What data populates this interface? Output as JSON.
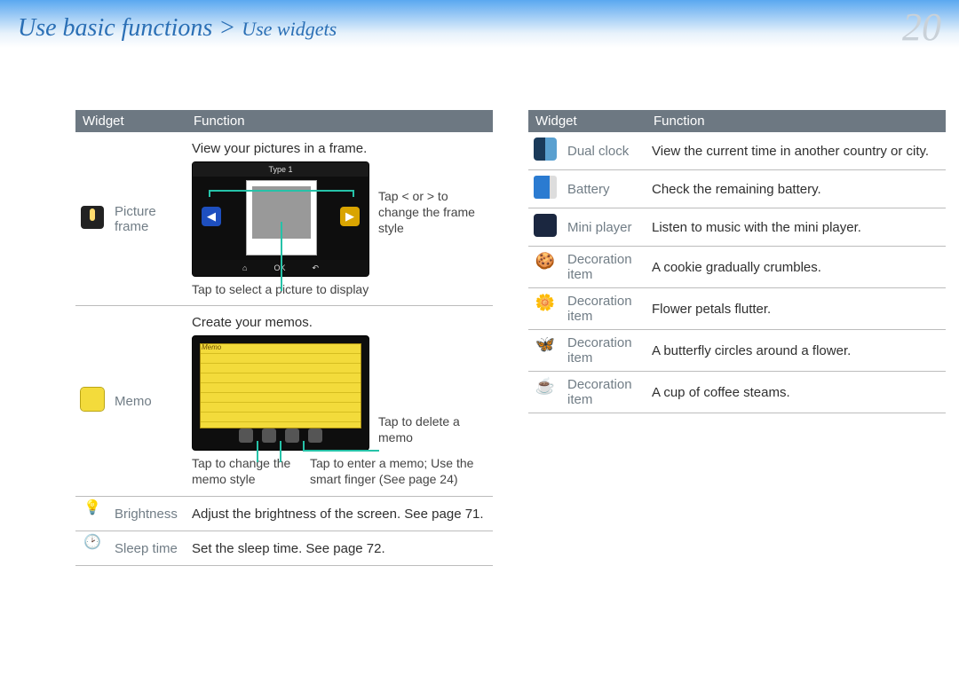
{
  "header": {
    "breadcrumb_main": "Use basic functions",
    "breadcrumb_sep": " > ",
    "breadcrumb_sub": "Use widgets",
    "page_number": "20"
  },
  "table_headers": {
    "widget": "Widget",
    "function": "Function"
  },
  "left": {
    "picture_frame": {
      "label": "Picture frame",
      "desc": "View your pictures in a frame.",
      "device_title": "Type 1",
      "ok": "OK",
      "arrow_note": "Tap < or > to change the frame style",
      "bottom_note": "Tap to select a picture to display"
    },
    "memo": {
      "label": "Memo",
      "desc": "Create your memos.",
      "pad_title": "Memo",
      "delete_note": "Tap to delete a memo",
      "style_note": "Tap to change the memo style",
      "enter_note": "Tap to enter a memo; Use the smart finger (See page 24)"
    },
    "brightness": {
      "label": "Brightness",
      "desc": "Adjust the brightness of the screen. See page 71."
    },
    "sleep": {
      "label": "Sleep time",
      "desc": "Set the sleep time. See page 72."
    }
  },
  "right": {
    "dual_clock": {
      "label": "Dual clock",
      "desc": "View the current time in another country or city."
    },
    "battery": {
      "label": "Battery",
      "desc": "Check the remaining battery."
    },
    "mini": {
      "label": "Mini player",
      "desc": "Listen to music with the mini player."
    },
    "cookie": {
      "label": "Decoration item",
      "desc": "A cookie gradually crumbles."
    },
    "flower": {
      "label": "Decoration item",
      "desc": "Flower petals flutter."
    },
    "butterfly": {
      "label": "Decoration item",
      "desc": "A butterfly circles around a flower."
    },
    "coffee": {
      "label": "Decoration item",
      "desc": "A cup of coffee steams."
    }
  }
}
